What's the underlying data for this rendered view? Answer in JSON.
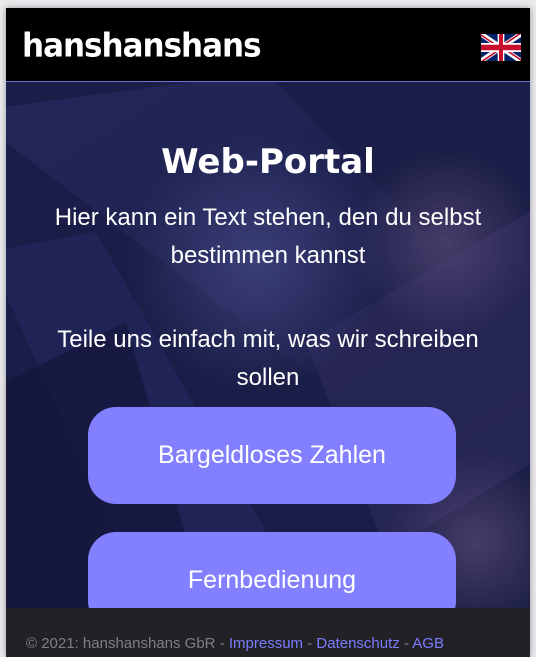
{
  "header": {
    "logo_text": "hanshanshans",
    "language_flag": "uk-flag-icon"
  },
  "hero": {
    "title": "Web-Portal",
    "text_1": "Hier kann ein Text stehen, den du selbst bestimmen kannst",
    "text_2": "Teile uns einfach mit, was wir schreiben sollen",
    "buttons": [
      {
        "label": "Bargeldloses Zahlen"
      },
      {
        "label": "Fernbedienung"
      }
    ]
  },
  "footer": {
    "copyright": "© 2021: hanshanshans GbR",
    "separator": "-",
    "links": [
      {
        "label": "Impressum"
      },
      {
        "label": "Datenschutz"
      },
      {
        "label": "AGB"
      }
    ]
  },
  "colors": {
    "accent_button": "#8280ff",
    "header_bg": "#000000",
    "footer_bg": "#222226",
    "footer_link": "#7b7bff"
  }
}
